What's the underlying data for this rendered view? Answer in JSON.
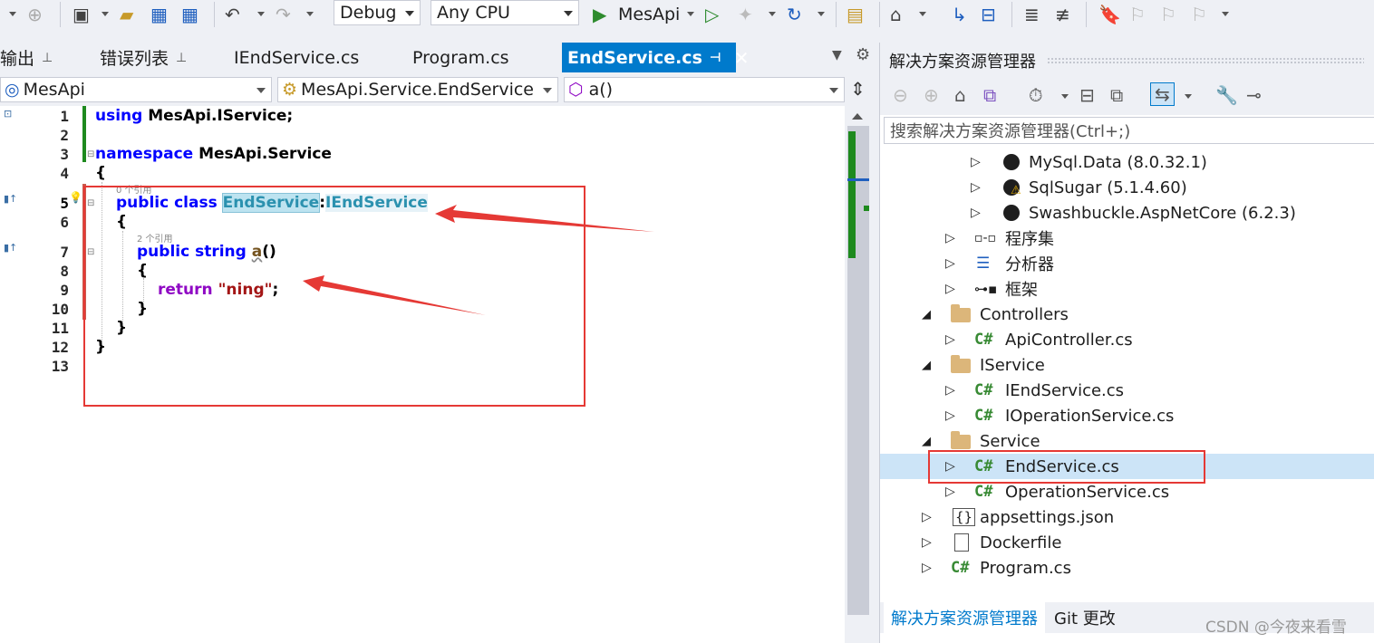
{
  "toolbar": {
    "config": "Debug",
    "platform": "Any CPU",
    "run_target": "MesApi"
  },
  "tabs": [
    {
      "label": "输出",
      "pinned": true
    },
    {
      "label": "错误列表",
      "pinned": true
    },
    {
      "label": "IEndService.cs"
    },
    {
      "label": "Program.cs"
    },
    {
      "label": "EndService.cs",
      "active": true
    }
  ],
  "nav": {
    "project": "MesApi",
    "type": "MesApi.Service.EndService",
    "member": "a()"
  },
  "code": {
    "line_numbers": [
      "1",
      "2",
      "3",
      "4",
      "5",
      "6",
      "7",
      "8",
      "9",
      "10",
      "11",
      "12",
      "13"
    ],
    "line1": {
      "kw": "using",
      "rest": "MesApi.IService;"
    },
    "line3": {
      "kw": "namespace",
      "rest": "MesApi.Service"
    },
    "line4": "{",
    "line5_refs": "0 个引用",
    "line5": {
      "kw": "public class",
      "cls": "EndService",
      "sep": ":",
      "iface": "IEndService"
    },
    "line6": "{",
    "line7_refs": "2 个引用",
    "line7": {
      "kw": "public string",
      "method": "a",
      "paren": "()"
    },
    "line8": "{",
    "line9": {
      "kw": "return",
      "str": "\"ning\"",
      "semi": ";"
    },
    "line10": "}",
    "line11": "}",
    "line12": "}"
  },
  "solution_explorer": {
    "title": "解决方案资源管理器",
    "search_placeholder": "搜索解决方案资源管理器(Ctrl+;)",
    "items": [
      {
        "label": "MySql.Data (8.0.32.1)",
        "icon": "nuget-package-icon"
      },
      {
        "label": "SqlSugar (5.1.4.60)",
        "icon": "nuget-package-warning-icon"
      },
      {
        "label": "Swashbuckle.AspNetCore (6.2.3)",
        "icon": "nuget-package-icon"
      },
      {
        "label": "程序集",
        "icon": "assembly-icon"
      },
      {
        "label": "分析器",
        "icon": "analyzer-icon"
      },
      {
        "label": "框架",
        "icon": "framework-icon"
      },
      {
        "label": "Controllers",
        "icon": "folder-icon"
      },
      {
        "label": "ApiController.cs",
        "icon": "csharp-file-icon"
      },
      {
        "label": "IService",
        "icon": "folder-icon"
      },
      {
        "label": "IEndService.cs",
        "icon": "csharp-file-icon"
      },
      {
        "label": "IOperationService.cs",
        "icon": "csharp-file-icon"
      },
      {
        "label": "Service",
        "icon": "folder-icon"
      },
      {
        "label": "EndService.cs",
        "icon": "csharp-file-icon",
        "selected": true
      },
      {
        "label": "OperationService.cs",
        "icon": "csharp-file-icon"
      },
      {
        "label": "appsettings.json",
        "icon": "json-file-icon"
      },
      {
        "label": "Dockerfile",
        "icon": "file-icon"
      },
      {
        "label": "Program.cs",
        "icon": "csharp-file-icon"
      }
    ],
    "csharp_glyph": "C#",
    "bottom_tabs": [
      {
        "label": "解决方案资源管理器",
        "active": true
      },
      {
        "label": "Git 更改"
      }
    ]
  },
  "watermark": "CSDN @今夜来看雪",
  "colors": {
    "accent": "#007acc",
    "keyword": "#0000ff",
    "type": "#2b91af",
    "string": "#a31515",
    "annotation_red": "#e53935"
  }
}
